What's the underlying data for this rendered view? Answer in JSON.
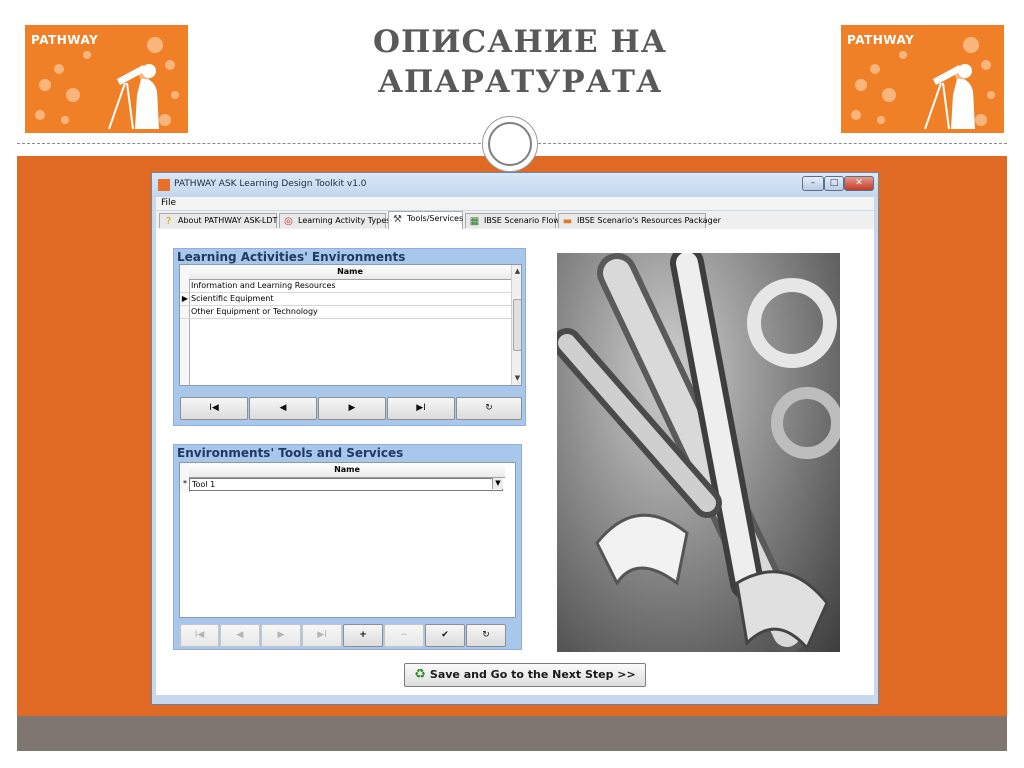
{
  "slide": {
    "title_line1": "ОПИСАНИЕ НА",
    "title_line2": "АПАРАТУРАТА",
    "logo_text": "PATHWAY",
    "colors": {
      "accent_orange": "#e06a24",
      "band_gray": "#7f7672",
      "logo_orange": "#f08028"
    }
  },
  "window": {
    "title": "PATHWAY ASK Learning Design Toolkit v1.0",
    "controls": {
      "minimize": "–",
      "maximize": "□",
      "close": "✕"
    }
  },
  "menu": {
    "file": "File"
  },
  "tabs": [
    {
      "label": "About PATHWAY ASK-LDT",
      "icon": "question-icon",
      "glyph": "?"
    },
    {
      "label": "Learning Activity Types",
      "icon": "target-icon",
      "glyph": "◎"
    },
    {
      "label": "Tools/Services",
      "icon": "tools-icon",
      "glyph": "⚒"
    },
    {
      "label": "IBSE Scenario Flow",
      "icon": "flow-icon",
      "glyph": "▦"
    },
    {
      "label": "IBSE Scenario's Resources Packager",
      "icon": "package-icon",
      "glyph": "▬"
    }
  ],
  "activities": {
    "title": "Learning Activities' Environments",
    "column": "Name",
    "rows": [
      {
        "name": "Information and Learning Resources",
        "marker": ""
      },
      {
        "name": "Scientific Equipment",
        "marker": "▶"
      },
      {
        "name": "Other Equipment or Technology",
        "marker": ""
      }
    ],
    "nav": {
      "first": "I◀",
      "prev": "◀",
      "next": "▶",
      "last": "▶I",
      "refresh": "↻"
    }
  },
  "tools": {
    "title": "Environments' Tools and Services",
    "column": "Name",
    "row_marker": "*",
    "input_value": "Tool 1",
    "nav": {
      "first": "I◀",
      "prev": "◀",
      "next": "▶",
      "last": "▶I",
      "add": "+",
      "delete": "−",
      "save": "✔",
      "refresh": "↻"
    }
  },
  "save_button": {
    "label": "Save and Go to the Next Step >>",
    "glyph": "♻"
  }
}
